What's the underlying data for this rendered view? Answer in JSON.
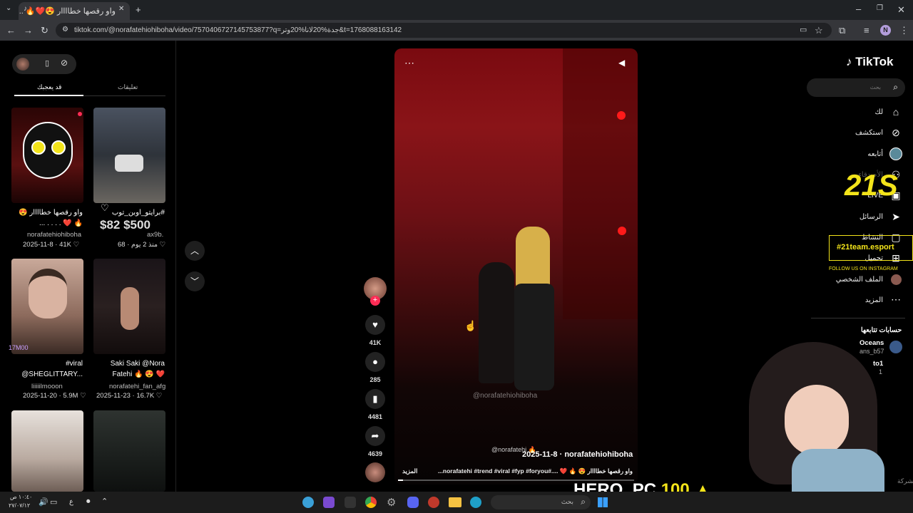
{
  "browser": {
    "tab_title": "واو رقصها خطاااار 😍❤️🔥 ...",
    "url": "tiktok.com/@norafatehiohiboha/video/7570406727145753877?q=جدة%20لانا%20وتر&t=1768088163142"
  },
  "left_panel": {
    "tabs": [
      "تعليقات",
      "قد يعجبك"
    ],
    "videos": [
      {
        "caption_line1": "واو رقصها خطاااار 😍",
        "caption_line2": "🔥 ❤️ . . . . ...",
        "user": "norafatehiohiboha",
        "date": "2025-11-8",
        "likes": "41K"
      },
      {
        "caption_line1": "#برايتو_اوبن_توب",
        "caption_line2": "$82 $500",
        "user": "ax9b.",
        "date": "منذ 2 يوم",
        "likes": "68"
      },
      {
        "caption_line1": "viral#",
        "caption_line2": "@SHEGLITTARY...",
        "user": "liiiiilmooon",
        "date": "2025-11-20",
        "likes": "5.9M"
      },
      {
        "caption_line1": "Saki Saki @Nora",
        "caption_line2": "Fatehi 🔥 😍 ❤️",
        "user": "norafatehi_fan_afg",
        "date": "2025-11-23",
        "likes": "16.7K"
      }
    ],
    "overlay_badge": "17M00"
  },
  "video": {
    "watermark": "@norafatehiohiboha",
    "author": "norafatehiohiboha",
    "date": "2025-11-8",
    "description": "واو رقصها خطاااار 😍 🔥 ❤️ ....#norafatehi #trend #viral #fyp #foryou...",
    "more_label": "المزيد",
    "tag_overlay": "@norafatehi 🔥"
  },
  "actions": {
    "likes": "41K",
    "comments": "285",
    "saves": "4481",
    "shares": "4639"
  },
  "sidebar": {
    "logo": "TikTok",
    "search_placeholder": "بحث",
    "items": [
      "لك",
      "استكشف",
      "أتابعه",
      "الأصدقاء",
      "LIVE",
      "الرسائل",
      "النشاط",
      "تحميل",
      "الملف الشخصي",
      "المزيد"
    ],
    "following_heading": "حسابات تتابعها",
    "following": [
      "Oceans",
      "ans_b57",
      "to1",
      "1"
    ],
    "footer": "الشركة"
  },
  "overlays": {
    "team_logo": "21S",
    "team_tag": "#21team.esport",
    "instagram_note": "FOLLOW US ON INSTAGRAM",
    "hero_text": "HERO_PC",
    "hero_num": "100"
  },
  "taskbar": {
    "time": "١٠:٤٠ ص",
    "date": "٢٧/٠٧/١٢",
    "search": "بحث",
    "lang": "ع"
  },
  "colors": {
    "tiktok_red": "#fe2c55",
    "accent_yellow": "#f3e41a"
  }
}
